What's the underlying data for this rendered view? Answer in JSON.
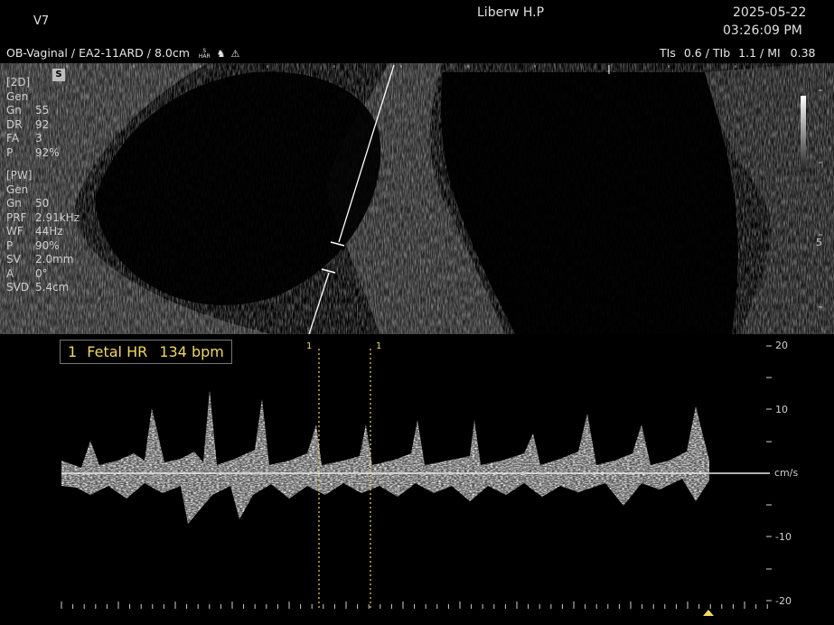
{
  "header": {
    "model": "V7",
    "hospital": "Liberw H.P",
    "date": "2025-05-22",
    "time": "03:26:09 PM"
  },
  "probe": {
    "preset": "OB-Vaginal",
    "transducer": "EA2-11ARD",
    "depth": "8.0cm",
    "har_label_top": "S",
    "har_label_bottom": "HAR"
  },
  "safety": {
    "tis_label": "TIs",
    "tis_value": "0.6",
    "tib_label": "TIb",
    "tib_value": "1.1",
    "mi_label": "MI",
    "mi_value": "0.38"
  },
  "badge_s": "S",
  "params_2d": {
    "header": "[2D]",
    "mode": "Gen",
    "rows": [
      {
        "k": "Gn",
        "v": "55"
      },
      {
        "k": "DR",
        "v": "92"
      },
      {
        "k": "FA",
        "v": "3"
      },
      {
        "k": "P",
        "v": "92%"
      }
    ]
  },
  "params_pw": {
    "header": "[PW]",
    "mode": "Gen",
    "rows": [
      {
        "k": "Gn",
        "v": "50"
      },
      {
        "k": "PRF",
        "v": "2.91kHz"
      },
      {
        "k": "WF",
        "v": "44Hz"
      },
      {
        "k": "P",
        "v": "90%"
      },
      {
        "k": "SV",
        "v": "2.0mm"
      },
      {
        "k": "A",
        "v": "0°"
      },
      {
        "k": "SVD",
        "v": "5.4cm"
      }
    ]
  },
  "measurement": {
    "index": "1",
    "label": "Fetal HR",
    "value": "134",
    "unit": "bpm"
  },
  "doppler_scale": {
    "unit": "cm/s",
    "ticks": [
      "20",
      "10",
      "-10",
      "-20"
    ]
  },
  "depth_mark": "5",
  "caliper_labels": [
    "1",
    "1"
  ],
  "colors": {
    "accent_yellow": "#f0d860",
    "background": "#000000"
  }
}
